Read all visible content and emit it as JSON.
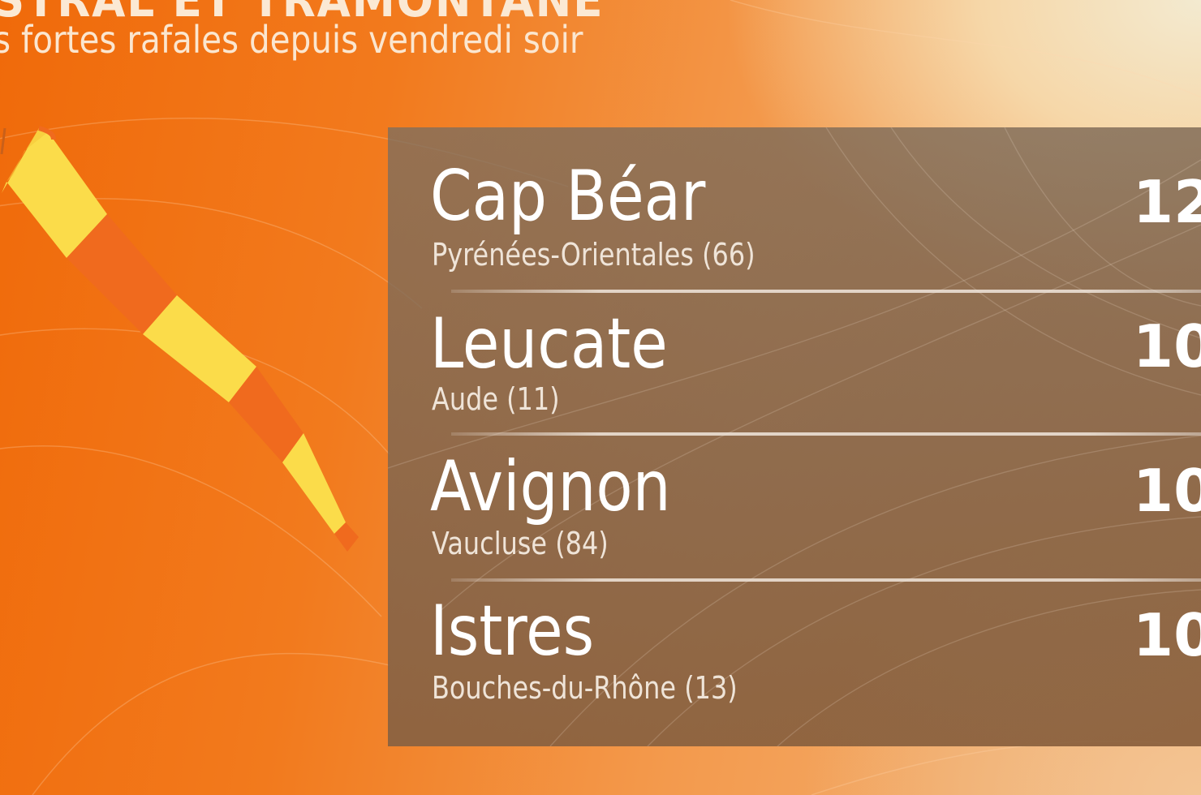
{
  "header": {
    "title": "ISTRAL ET TRAMONTANE",
    "subtitle": "s fortes rafales depuis vendredi soir"
  },
  "rows": [
    {
      "city": "Cap Béar",
      "department": "Pyrénées-Orientales (66)",
      "value": "12"
    },
    {
      "city": "Leucate",
      "department": "Aude (11)",
      "value": "10"
    },
    {
      "city": "Avignon",
      "department": "Vaucluse (84)",
      "value": "10"
    },
    {
      "city": "Istres",
      "department": "Bouches-du-Rhône (13)",
      "value": "10"
    }
  ],
  "icons": {
    "windsock": "windsock-icon"
  },
  "colors": {
    "background_orange": "#f06a0a",
    "panel_brown": "#7a6050",
    "windsock_yellow": "#fbdc4a",
    "windsock_orange": "#f26a1a"
  }
}
